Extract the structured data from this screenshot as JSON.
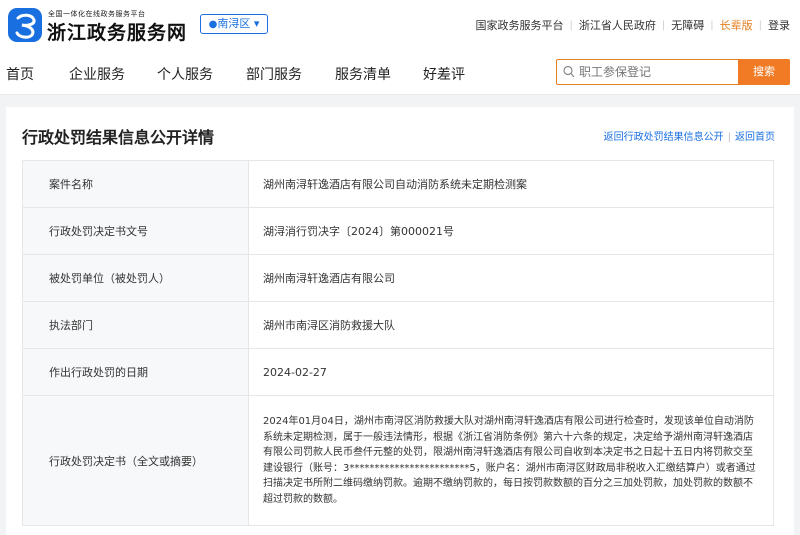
{
  "header": {
    "logo_subtitle": "全国一体化在线政务服务平台",
    "logo_title": "浙江政务服务网",
    "region": "南浔区",
    "top_links": [
      {
        "label": "国家政务服务平台"
      },
      {
        "label": "浙江省人民政府"
      },
      {
        "label": "无障碍"
      },
      {
        "label": "长辈版"
      },
      {
        "label": "登录"
      }
    ]
  },
  "nav": {
    "items": [
      "首页",
      "企业服务",
      "个人服务",
      "部门服务",
      "服务清单",
      "好差评"
    ],
    "search_placeholder": "职工参保登记",
    "search_button": "搜索"
  },
  "page": {
    "title": "行政处罚结果信息公开详情",
    "link_back_list": "返回行政处罚结果信息公开",
    "link_home": "返回首页",
    "rows": [
      {
        "key": "案件名称",
        "value": "湖州南浔轩逸酒店有限公司自动消防系统未定期检测案"
      },
      {
        "key": "行政处罚决定书文号",
        "value": "湖浔消行罚决字〔2024〕第000021号"
      },
      {
        "key": "被处罚单位（被处罚人）",
        "value": "湖州南浔轩逸酒店有限公司"
      },
      {
        "key": "执法部门",
        "value": "湖州市南浔区消防救援大队"
      },
      {
        "key": "作出行政处罚的日期",
        "value": "2024-02-27"
      },
      {
        "key": "行政处罚决定书（全文或摘要）",
        "value": "2024年01月04日，湖州市南浔区消防救援大队对湖州南浔轩逸酒店有限公司进行检查时，发现该单位自动消防系统未定期检测，属于一般违法情形，根据《浙江省消防条例》第六十六条的规定，决定给予湖州南浔轩逸酒店有限公司罚款人民币叁仟元整的处罚，限湖州南浔轩逸酒店有限公司自收到本决定书之日起十五日内将罚款交至建设银行（账号：3************************5，账户名：湖州市南浔区财政局非税收入汇缴结算户）或者通过扫描决定书所附二维码缴纳罚款。逾期不缴纳罚款的，每日按罚款数额的百分之三加处罚款，加处罚款的数额不超过罚款的数额。"
      }
    ]
  },
  "colors": {
    "brand_blue": "#1a6fe0",
    "accent_orange": "#f07b24"
  }
}
